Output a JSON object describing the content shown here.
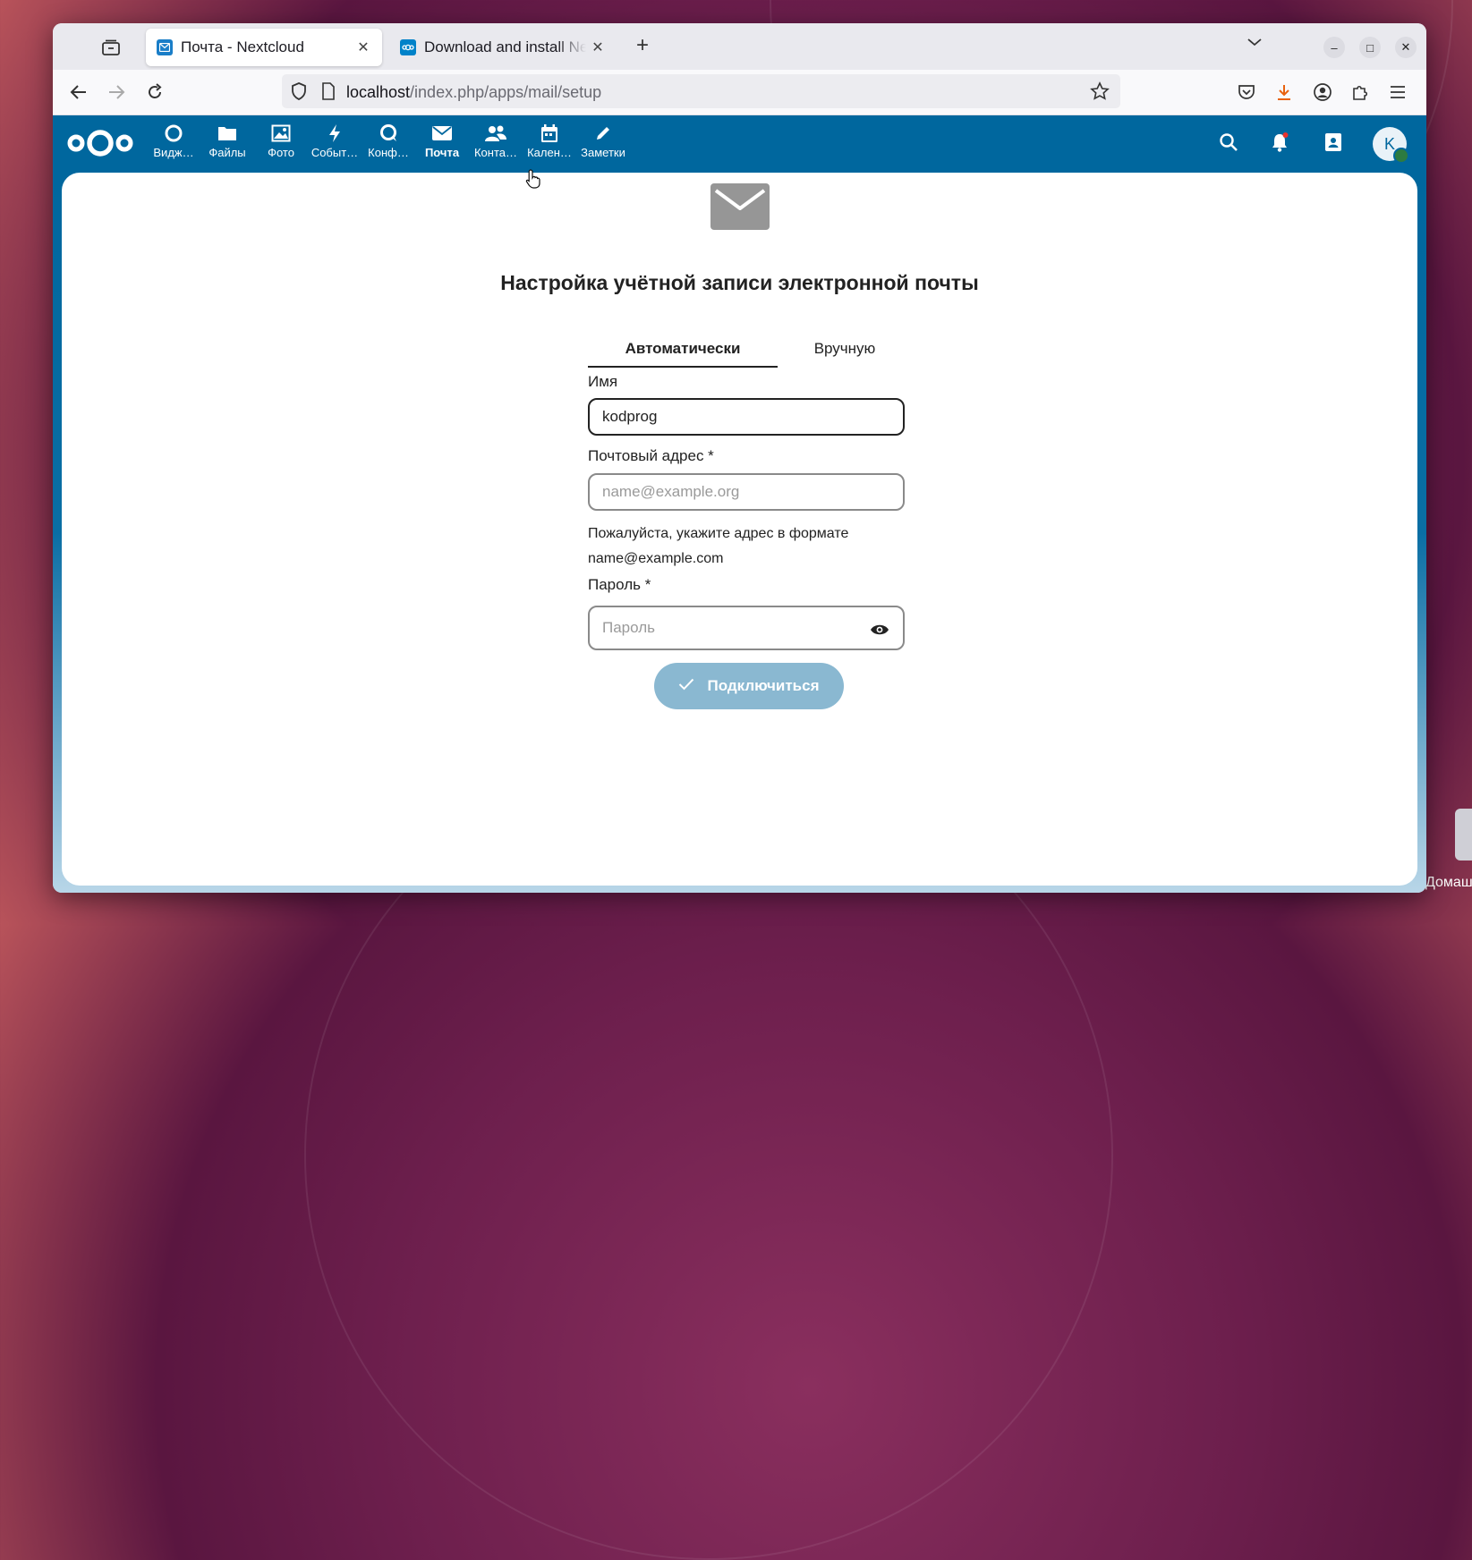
{
  "browser": {
    "tabs": [
      {
        "title": "Почта - Nextcloud",
        "active": true
      },
      {
        "title": "Download and install Nextcloud",
        "active": false
      }
    ],
    "url": {
      "host": "localhost",
      "path": "/index.php/apps/mail/setup"
    }
  },
  "header": {
    "apps": [
      {
        "label": "Видж…",
        "icon": "dashboard-icon"
      },
      {
        "label": "Файлы",
        "icon": "folder-icon"
      },
      {
        "label": "Фото",
        "icon": "image-icon"
      },
      {
        "label": "Событ…",
        "icon": "activity-icon"
      },
      {
        "label": "Конф…",
        "icon": "talk-icon"
      },
      {
        "label": "Почта",
        "icon": "mail-icon",
        "active": true
      },
      {
        "label": "Конта…",
        "icon": "contacts-icon"
      },
      {
        "label": "Кален…",
        "icon": "calendar-icon"
      },
      {
        "label": "Заметки",
        "icon": "pencil-icon"
      }
    ],
    "avatar_initial": "K",
    "colors": {
      "primary": "#00679e",
      "button_disabled": "#8ab8d1"
    }
  },
  "setup": {
    "title": "Настройка учётной записи электронной почты",
    "tab_auto": "Автоматически",
    "tab_manual": "Вручную",
    "name_label": "Имя",
    "name_value": "kodprog",
    "email_label": "Почтовый адрес *",
    "email_placeholder": "name@example.org",
    "hint_line1": "Пожалуйста, укажите адрес в формате",
    "hint_line2": "name@example.com",
    "password_label": "Пароль *",
    "password_placeholder": "Пароль",
    "connect_label": "Подключиться"
  },
  "desktop": {
    "label": "Домаш"
  }
}
